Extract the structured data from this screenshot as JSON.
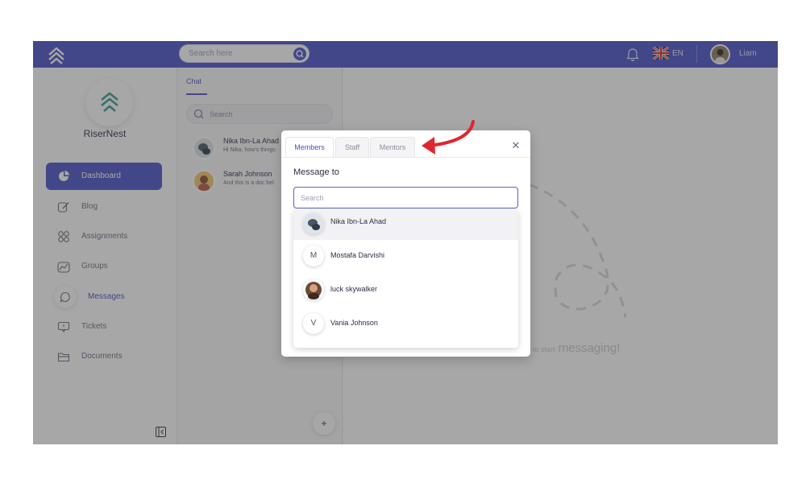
{
  "topbar": {
    "search_placeholder": "Search here",
    "language": "EN",
    "user_name": "Liam",
    "icons": [
      "logo-icon",
      "search-icon",
      "bell-icon",
      "uk-flag-icon",
      "avatar"
    ]
  },
  "sidebar": {
    "brand": "RiserNest",
    "items": [
      {
        "label": "Dashboard",
        "icon": "pie-chart-icon",
        "state": "active"
      },
      {
        "label": "Blog",
        "icon": "edit-icon"
      },
      {
        "label": "Assignments",
        "icon": "shapes-icon"
      },
      {
        "label": "Groups",
        "icon": "chart-icon"
      },
      {
        "label": "Messages",
        "icon": "chat-bubble-icon",
        "state": "selected"
      },
      {
        "label": "Tickets",
        "icon": "ticket-icon"
      },
      {
        "label": "Documents",
        "icon": "folder-icon"
      }
    ]
  },
  "chat": {
    "tab": "Chat",
    "search_placeholder": "Search",
    "conversations": [
      {
        "name": "Nika Ibn-La Ahad",
        "preview": "Hi Nika, how's things"
      },
      {
        "name": "Sarah Johnson",
        "preview": "And this is a doc bel"
      }
    ],
    "add_label": "+"
  },
  "main": {
    "empty_small": "to start",
    "empty_large": "messaging!"
  },
  "modal": {
    "tabs": [
      "Members",
      "Staff",
      "Mentors"
    ],
    "active_tab": "Members",
    "close_label": "✕",
    "title": "Message to",
    "search_placeholder": "Search",
    "results": [
      {
        "name": "Nika Ibn-La Ahad",
        "avatar": "photo",
        "initial": ""
      },
      {
        "name": "Mostafa Darvishi",
        "avatar": "initial",
        "initial": "M"
      },
      {
        "name": "luck skywalker",
        "avatar": "photo",
        "initial": ""
      },
      {
        "name": "Vania Johnson",
        "avatar": "initial",
        "initial": "V"
      }
    ]
  },
  "colors": {
    "accent": "#4750c9",
    "annotation_arrow": "#e0262e"
  }
}
